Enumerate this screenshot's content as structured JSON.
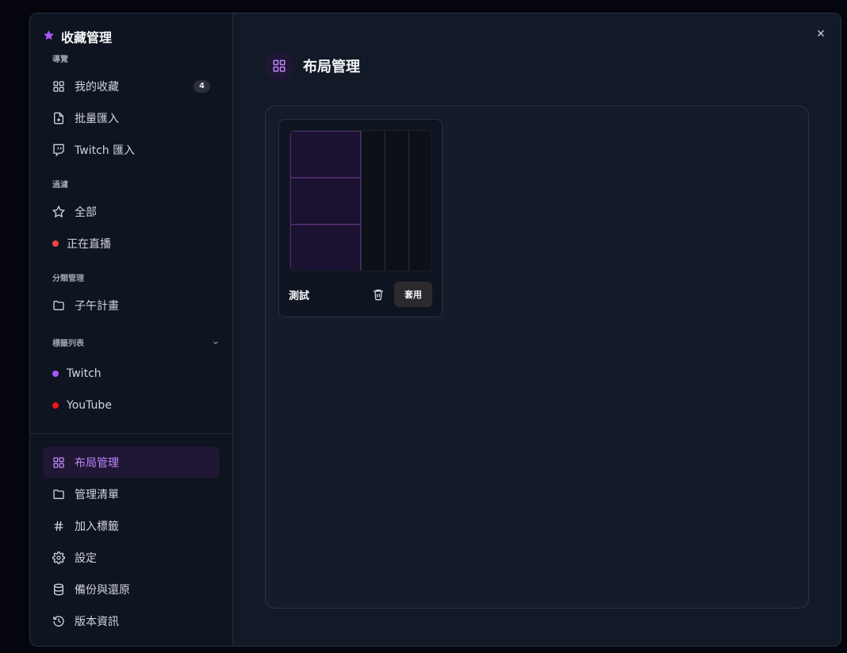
{
  "sidebar": {
    "title": "收藏管理",
    "sections": {
      "nav_label": "導覽",
      "filter_label": "過濾",
      "category_label": "分類管理",
      "tags_label": "標籤列表"
    },
    "nav": [
      {
        "label": "我的收藏",
        "icon": "grid-icon",
        "badge": "4"
      },
      {
        "label": "批量匯入",
        "icon": "file-plus-icon"
      },
      {
        "label": "Twitch 匯入",
        "icon": "twitch-icon"
      }
    ],
    "filters": [
      {
        "label": "全部",
        "icon": "star-outline-icon"
      },
      {
        "label": "正在直播",
        "icon": "live-dot-icon",
        "color": "#ef4444"
      }
    ],
    "categories": [
      {
        "label": "子午計畫",
        "icon": "folder-icon"
      }
    ],
    "tags": [
      {
        "label": "Twitch",
        "color": "#a855f7"
      },
      {
        "label": "YouTube",
        "color": "#ef1515"
      }
    ],
    "bottom": [
      {
        "label": "布局管理",
        "icon": "grid-icon",
        "active": true
      },
      {
        "label": "管理清單",
        "icon": "folder-icon"
      },
      {
        "label": "加入標籤",
        "icon": "hash-icon"
      },
      {
        "label": "設定",
        "icon": "gear-icon"
      },
      {
        "label": "備份與還原",
        "icon": "database-icon"
      },
      {
        "label": "版本資訊",
        "icon": "history-icon"
      }
    ]
  },
  "main": {
    "title": "布局管理",
    "layouts": [
      {
        "name": "測試",
        "apply_label": "套用"
      }
    ]
  },
  "colors": {
    "accent": "#a855f7",
    "live": "#ef4444"
  }
}
